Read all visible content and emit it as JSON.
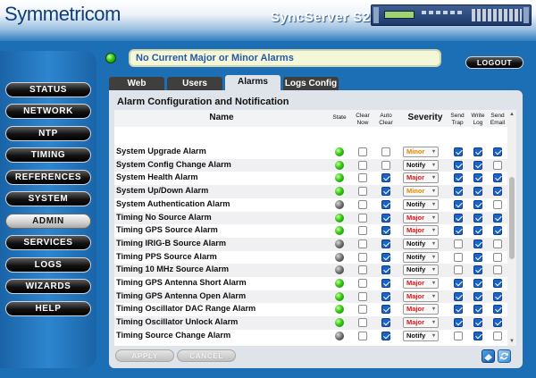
{
  "header": {
    "logo": "Symmetricom",
    "logo_sub": "",
    "product": "SyncServer S250"
  },
  "sidebar": {
    "items": [
      {
        "label": "STATUS",
        "active": false
      },
      {
        "label": "NETWORK",
        "active": false
      },
      {
        "label": "NTP",
        "active": false
      },
      {
        "label": "TIMING",
        "active": false
      },
      {
        "label": "REFERENCES",
        "active": false
      },
      {
        "label": "SYSTEM",
        "active": false
      },
      {
        "label": "ADMIN",
        "active": true
      },
      {
        "label": "SERVICES",
        "active": false
      },
      {
        "label": "LOGS",
        "active": false
      },
      {
        "label": "WIZARDS",
        "active": false
      },
      {
        "label": "HELP",
        "active": false
      }
    ]
  },
  "status": {
    "message": "No Current Major or Minor Alarms",
    "logout_label": "LOGOUT"
  },
  "tabs": [
    {
      "label": "Web",
      "active": false
    },
    {
      "label": "Users",
      "active": false
    },
    {
      "label": "Alarms",
      "active": true
    },
    {
      "label": "Logs Config",
      "active": false
    }
  ],
  "panel": {
    "title": "Alarm Configuration and Notification"
  },
  "table": {
    "headers": {
      "name": "Name",
      "state": "State",
      "clear_now": "Clear Now",
      "auto_clear": "Auto Clear",
      "severity": "Severity",
      "send_trap": "Send Trap",
      "write_log": "Write Log",
      "send_email": "Send Email"
    },
    "rows": [
      {
        "name": "System Upgrade Alarm",
        "state": "green",
        "clear_now": false,
        "auto_clear": false,
        "severity": "Minor",
        "send_trap": true,
        "write_log": true,
        "send_email": true
      },
      {
        "name": "System Config Change Alarm",
        "state": "green",
        "clear_now": false,
        "auto_clear": false,
        "severity": "Notify",
        "send_trap": true,
        "write_log": true,
        "send_email": false
      },
      {
        "name": "System  Health Alarm",
        "state": "green",
        "clear_now": false,
        "auto_clear": true,
        "severity": "Major",
        "send_trap": true,
        "write_log": true,
        "send_email": true
      },
      {
        "name": "System Up/Down Alarm",
        "state": "green",
        "clear_now": false,
        "auto_clear": true,
        "severity": "Minor",
        "send_trap": true,
        "write_log": true,
        "send_email": true
      },
      {
        "name": "System Authentication Alarm",
        "state": "gray",
        "clear_now": false,
        "auto_clear": true,
        "severity": "Notify",
        "send_trap": true,
        "write_log": true,
        "send_email": false
      },
      {
        "name": "Timing No Source Alarm",
        "state": "green",
        "clear_now": false,
        "auto_clear": true,
        "severity": "Major",
        "send_trap": true,
        "write_log": true,
        "send_email": true
      },
      {
        "name": "Timing GPS Source Alarm",
        "state": "green",
        "clear_now": false,
        "auto_clear": true,
        "severity": "Major",
        "send_trap": true,
        "write_log": true,
        "send_email": true
      },
      {
        "name": "Timing IRIG-B Source Alarm",
        "state": "gray",
        "clear_now": false,
        "auto_clear": true,
        "severity": "Notify",
        "send_trap": false,
        "write_log": true,
        "send_email": false
      },
      {
        "name": "Timing PPS Source Alarm",
        "state": "gray",
        "clear_now": false,
        "auto_clear": true,
        "severity": "Notify",
        "send_trap": false,
        "write_log": true,
        "send_email": false
      },
      {
        "name": "Timing 10 MHz Source Alarm",
        "state": "gray",
        "clear_now": false,
        "auto_clear": true,
        "severity": "Notify",
        "send_trap": false,
        "write_log": true,
        "send_email": false
      },
      {
        "name": "Timing GPS Antenna Short Alarm",
        "state": "green",
        "clear_now": false,
        "auto_clear": true,
        "severity": "Major",
        "send_trap": true,
        "write_log": true,
        "send_email": true
      },
      {
        "name": "Timing GPS Antenna Open Alarm",
        "state": "green",
        "clear_now": false,
        "auto_clear": true,
        "severity": "Major",
        "send_trap": true,
        "write_log": true,
        "send_email": true
      },
      {
        "name": "Timing Oscillator DAC Range Alarm",
        "state": "green",
        "clear_now": false,
        "auto_clear": true,
        "severity": "Major",
        "send_trap": true,
        "write_log": true,
        "send_email": true
      },
      {
        "name": "Timing Oscillator Unlock Alarm",
        "state": "green",
        "clear_now": false,
        "auto_clear": true,
        "severity": "Major",
        "send_trap": true,
        "write_log": true,
        "send_email": true
      },
      {
        "name": "Timing Source Change Alarm",
        "state": "gray",
        "clear_now": false,
        "auto_clear": true,
        "severity": "Notify",
        "send_trap": false,
        "write_log": true,
        "send_email": false
      }
    ]
  },
  "footer": {
    "apply_label": "APPLY",
    "cancel_label": "CANCEL"
  },
  "colors": {
    "minor": "#e88a00",
    "major": "#d81818",
    "notify": "#111111"
  }
}
